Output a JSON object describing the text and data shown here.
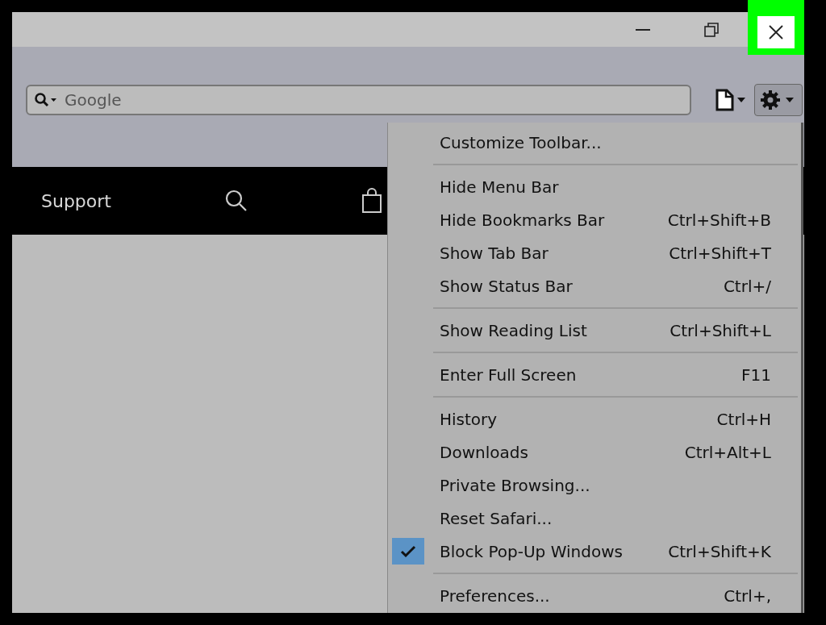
{
  "title_bar": {
    "close_highlighted": true
  },
  "toolbar": {
    "search": {
      "placeholder": "Google"
    }
  },
  "nav": {
    "label": "Support"
  },
  "menu": {
    "groups": [
      [
        {
          "label": "Customize Toolbar...",
          "checked": false
        }
      ],
      [
        {
          "label": "Hide Menu Bar",
          "checked": false
        },
        {
          "label": "Hide Bookmarks Bar",
          "shortcut": "Ctrl+Shift+B",
          "checked": false
        },
        {
          "label": "Show Tab Bar",
          "shortcut": "Ctrl+Shift+T",
          "checked": false
        },
        {
          "label": "Show Status Bar",
          "shortcut": "Ctrl+/",
          "checked": false
        }
      ],
      [
        {
          "label": "Show Reading List",
          "shortcut": "Ctrl+Shift+L",
          "checked": false
        }
      ],
      [
        {
          "label": "Enter Full Screen",
          "shortcut": "F11",
          "checked": false
        }
      ],
      [
        {
          "label": "History",
          "shortcut": "Ctrl+H",
          "checked": false
        },
        {
          "label": "Downloads",
          "shortcut": "Ctrl+Alt+L",
          "checked": false
        },
        {
          "label": "Private Browsing...",
          "checked": false
        },
        {
          "label": "Reset Safari...",
          "checked": false
        },
        {
          "label": "Block Pop-Up Windows",
          "shortcut": "Ctrl+Shift+K",
          "checked": true
        }
      ],
      [
        {
          "label": "Preferences...",
          "shortcut": "Ctrl+,",
          "checked": false
        }
      ]
    ]
  }
}
